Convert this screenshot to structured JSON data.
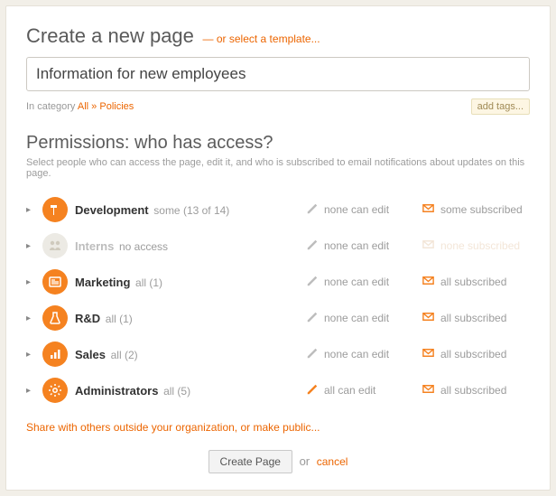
{
  "header": {
    "title": "Create a new page",
    "template_link": "— or select a template..."
  },
  "page_name": "Information for new employees",
  "category": {
    "label": "In category",
    "crumb_all": "All",
    "crumb_sep": "»",
    "crumb_current": "Policies"
  },
  "add_tags_label": "add tags...",
  "permissions": {
    "title": "Permissions: who has access?",
    "subtitle": "Select people who can access the page, edit it, and who is subscribed to email notifications about updates on this page.",
    "groups": [
      {
        "name": "Development",
        "access": "some (13 of 14)",
        "edit": "none can edit",
        "subscribe": "some subscribed",
        "avatar": "hammer",
        "active": true,
        "edit_on": false,
        "sub_on": true
      },
      {
        "name": "Interns",
        "access": "no access",
        "edit": "none can edit",
        "subscribe": "none subscribed",
        "avatar": "people",
        "active": false,
        "edit_on": false,
        "sub_on": false
      },
      {
        "name": "Marketing",
        "access": "all (1)",
        "edit": "none can edit",
        "subscribe": "all subscribed",
        "avatar": "news",
        "active": true,
        "edit_on": false,
        "sub_on": true
      },
      {
        "name": "R&D",
        "access": "all (1)",
        "edit": "none can edit",
        "subscribe": "all subscribed",
        "avatar": "flask",
        "active": true,
        "edit_on": false,
        "sub_on": true
      },
      {
        "name": "Sales",
        "access": "all (2)",
        "edit": "none can edit",
        "subscribe": "all subscribed",
        "avatar": "chart",
        "active": true,
        "edit_on": false,
        "sub_on": true
      },
      {
        "name": "Administrators",
        "access": "all (5)",
        "edit": "all can edit",
        "subscribe": "all subscribed",
        "avatar": "gear",
        "active": true,
        "edit_on": true,
        "sub_on": true
      }
    ]
  },
  "share_link": "Share with others outside your organization, or make public...",
  "actions": {
    "create": "Create Page",
    "or": "or",
    "cancel": "cancel"
  }
}
